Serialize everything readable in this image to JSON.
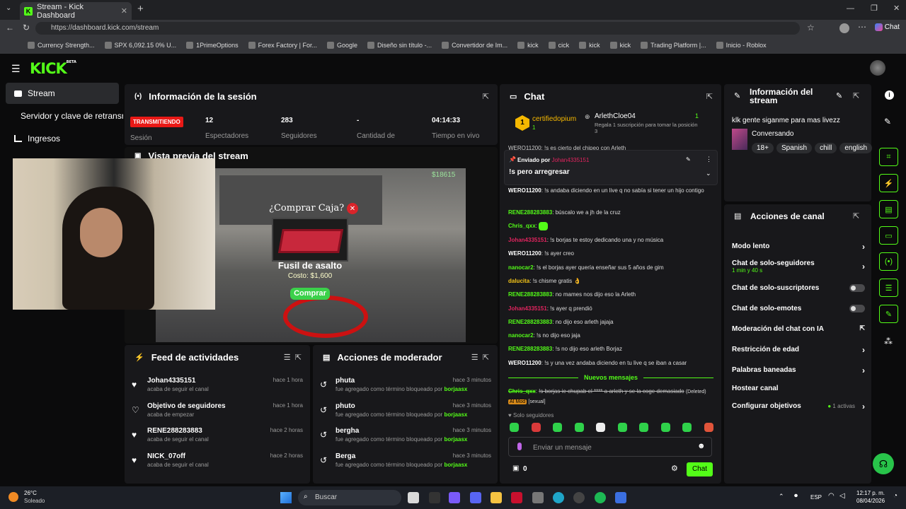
{
  "browser": {
    "tab_title": "Stream - Kick Dashboard",
    "url": "https://dashboard.kick.com/stream",
    "copilot": "Chat",
    "bookmarks": [
      "Currency Strength...",
      "SPX 6,092.15 0% U...",
      "1PrimeOptions",
      "Forex Factory | For...",
      "Google",
      "Diseño sin título -...",
      "Convertidor de Im...",
      "kick",
      "cick",
      "kick",
      "kick",
      "Trading Platform |...",
      "Inicio - Roblox"
    ]
  },
  "brand": {
    "logo": "KICK",
    "badge": "BETA"
  },
  "nav": {
    "stream": "Stream",
    "server": "Servidor y clave de retransn",
    "income": "Ingresos"
  },
  "session": {
    "title": "Información de la sesión",
    "badge": "TRANSMITIENDO",
    "badge_label": "Sesión",
    "stats": [
      {
        "value": "12",
        "label": "Espectadores"
      },
      {
        "value": "283",
        "label": "Seguidores"
      },
      {
        "value": "-",
        "label": "Cantidad de"
      },
      {
        "value": "04:14:33",
        "label": "Tiempo en vivo"
      }
    ]
  },
  "preview": {
    "title": "Vista previa del stream",
    "game": {
      "prompt": "¿Comprar Caja?",
      "item": "Fusil de asalto",
      "cost": "Costo: $1,600",
      "buy": "Comprar",
      "money": "$18615"
    }
  },
  "feed": {
    "title": "Feed de actividades",
    "items": [
      {
        "name": "Johan4335151",
        "sub": "acaba de seguir el canal",
        "time": "hace 1 hora"
      },
      {
        "name": "Objetivo de seguidores",
        "sub": "acaba de empezar",
        "time": "hace 1 hora"
      },
      {
        "name": "RENE288283883",
        "sub": "acaba de seguir el canal",
        "time": "hace 2 horas"
      },
      {
        "name": "NICK_07off",
        "sub": "acaba de seguir el canal",
        "time": "hace 2 horas"
      }
    ]
  },
  "mod": {
    "title": "Acciones de moderador",
    "items": [
      {
        "name": "phuta",
        "pre": "fue agregado como término bloqueado por ",
        "by": "borjaasx",
        "time": "hace 3 minutos"
      },
      {
        "name": "phuto",
        "pre": "fue agregado como término bloqueado por ",
        "by": "borjaasx",
        "time": "hace 3 minutos"
      },
      {
        "name": "bergha",
        "pre": "fue agregado como término bloqueado por ",
        "by": "borjaasx",
        "time": "hace 3 minutos"
      },
      {
        "name": "Berga",
        "pre": "fue agregado como término bloqueado por ",
        "by": "borjaasx",
        "time": "hace 3 minutos"
      }
    ]
  },
  "chat": {
    "title": "Chat",
    "top_gifter": {
      "name": "certifiedopium",
      "count": "1",
      "rank": "1"
    },
    "second": {
      "name": "ArlethCloe04",
      "sub": "Regala 1 suscripción para tomar la posición 3",
      "count": "1"
    },
    "peek": "WERO11200: !s es cierto del chipeo con Arleth",
    "pinned": {
      "label": "Enviado por ",
      "by": "Johan4335151",
      "text": "!s pero arregresar"
    },
    "messages": [
      {
        "user": "WERO11200",
        "text": "!s andaba diciendo en un live q no sabía si tener un hijo contigo",
        "color": "w"
      },
      {
        "user": "RENE288283883",
        "text": "búscalo we a jh de la cruz",
        "color": "g"
      },
      {
        "user": "Chris_qxx",
        "text": "",
        "color": "g"
      },
      {
        "user": "Johan4335151",
        "text": "!s borjas te estoy dedicando una y no música",
        "color": "r"
      },
      {
        "user": "WERO11200",
        "text": "!s ayer creo",
        "color": "w"
      },
      {
        "user": "nanocar2",
        "text": "!s el borjas ayer quería enseñar sus 5 años de gim",
        "color": "g"
      },
      {
        "user": "dalucita",
        "text": "!s chisme gratis 👌",
        "color": "y"
      },
      {
        "user": "RENE288283883",
        "text": "no mames nos dijo eso la Arleth",
        "color": "g"
      },
      {
        "user": "Johan4335151",
        "text": "!s ayer q prendió",
        "color": "r"
      },
      {
        "user": "RENE288283883",
        "text": "no dijo eso arleth jajaja",
        "color": "g"
      },
      {
        "user": "nanocar2",
        "text": "!s no dijo eso jaja",
        "color": "g"
      },
      {
        "user": "RENE288283883",
        "text": "!s no dijo eso arleth Borjaz",
        "color": "g"
      },
      {
        "user": "WERO11200",
        "text": "!s y una vez andaba diciendo en tu live q se iban a casar",
        "color": "w"
      }
    ],
    "new_messages": "Nuevos mensajes",
    "deleted": {
      "user": "Chris_qxx",
      "text": "!s borjas ie chupab el **** a arleth y se la coge demasiado",
      "tag": "(Deleted)",
      "ai": "AI Mod",
      "reason": "[sexual]"
    },
    "mode": "Solo seguidores",
    "placeholder": "Enviar un mensaje",
    "count": "0",
    "send": "Chat"
  },
  "info": {
    "title_line1": "Información del",
    "title_line2": "stream",
    "stream_title": "klk gente siganme para mas livezz",
    "category": "Conversando",
    "tags": [
      "18+",
      "Spanish",
      "chill",
      "english"
    ]
  },
  "actions": {
    "title": "Acciones de canal",
    "items": [
      {
        "label": "Modo lento",
        "kind": "arrow"
      },
      {
        "label": "Chat de solo-seguidores",
        "sub": "1 min y 40 s",
        "kind": "arrow"
      },
      {
        "label": "Chat de solo-suscriptores",
        "kind": "toggle"
      },
      {
        "label": "Chat de solo-emotes",
        "kind": "toggle"
      },
      {
        "label": "Moderación del chat con IA",
        "kind": "ext"
      },
      {
        "label": "Restricción de edad",
        "kind": "arrow"
      },
      {
        "label": "Palabras baneadas",
        "kind": "arrow"
      },
      {
        "label": "Hostear canal",
        "kind": "none"
      },
      {
        "label": "Configurar objetivos",
        "kind": "arrow",
        "status": "1 activas"
      }
    ]
  },
  "taskbar": {
    "temp": "26°C",
    "weather": "Soleado",
    "search": "Buscar",
    "lang": "ESP",
    "time": "12:17 p. m.",
    "date": "08/04/2026"
  },
  "colors": {
    "accent": "#53fc18",
    "panel": "#18181b",
    "live": "#e91916"
  }
}
